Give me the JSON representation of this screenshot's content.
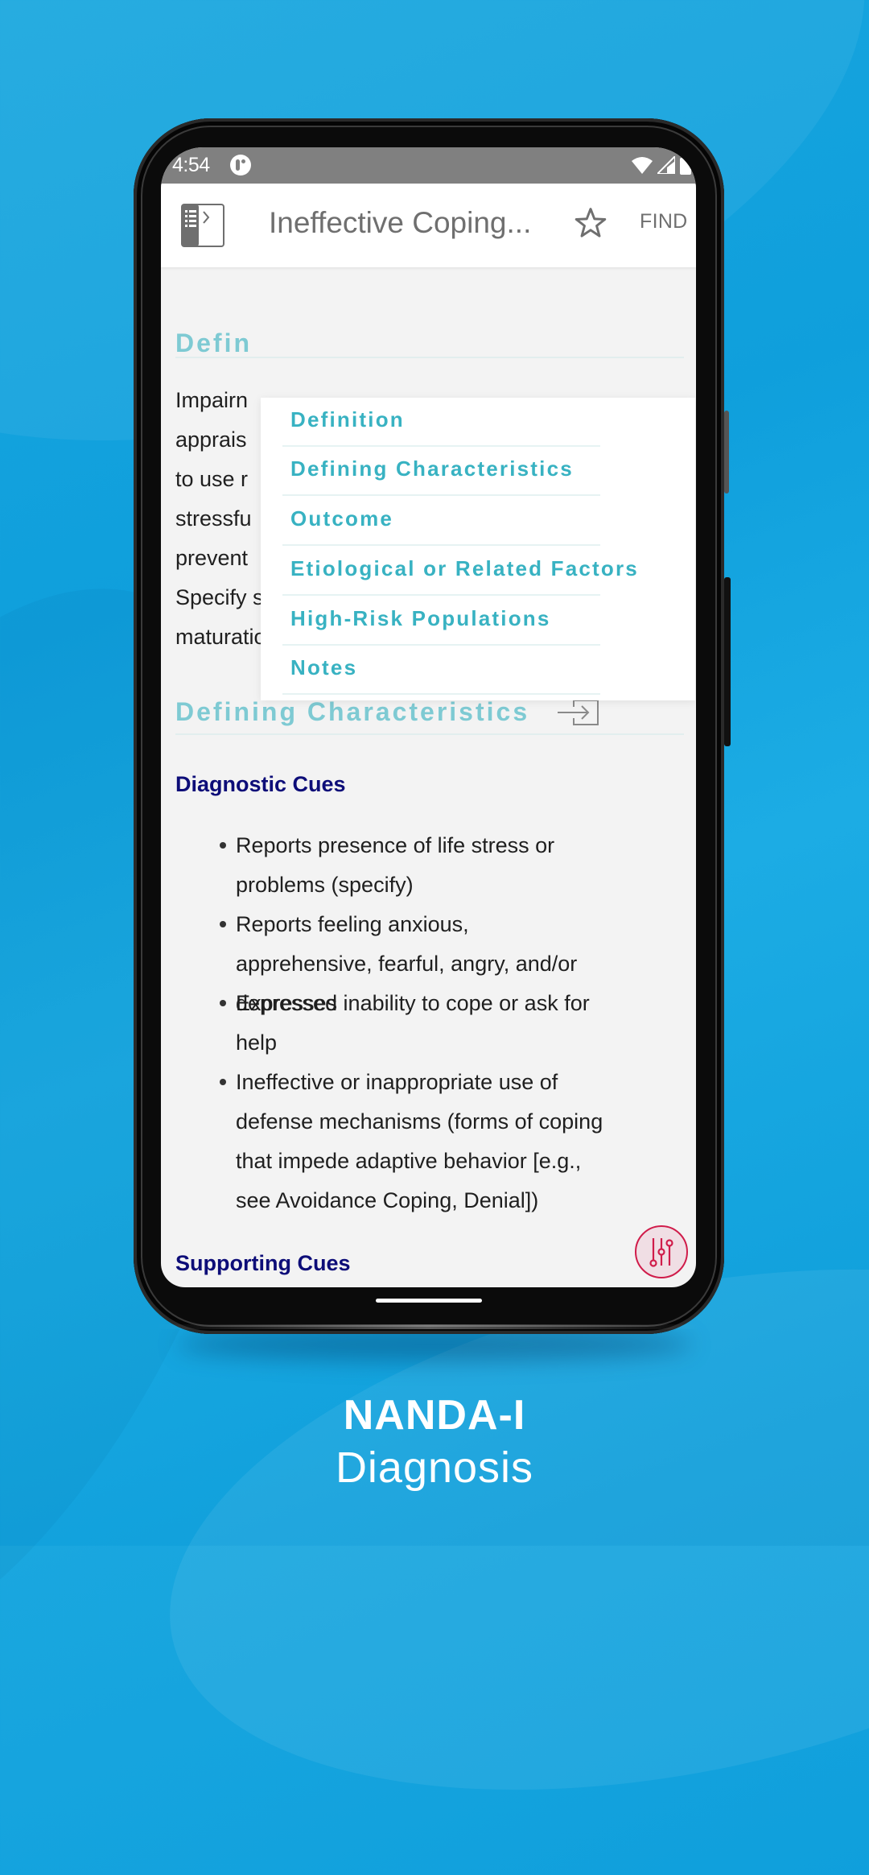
{
  "status_bar": {
    "time": "4:54",
    "icons": [
      "app-notification-icon",
      "wifi-icon",
      "cellular-signal-icon",
      "battery-icon"
    ]
  },
  "app_bar": {
    "title": "Ineffective Coping...",
    "toc_icon": "table-of-contents-icon",
    "favorite_icon": "star-outline-icon",
    "find_label": "FIND"
  },
  "content": {
    "definition_heading": "Defin",
    "definition_lines": [
      "Impairn",
      "apprais",
      "to use r",
      "stressfu",
      "prevent",
      "Specify stressor(s) (e.g., situational or",
      "maturational crises, uncertainty)"
    ],
    "defining_characteristics_heading": "Defining Characteristics",
    "jump_icon": "enter-section-icon",
    "diagnostic_cues_heading": "Diagnostic Cues",
    "diagnostic_cues": [
      "Reports presence of life stress or problems (specify)",
      "Reports feeling anxious, apprehensive, fearful, angry, and/or depressed",
      "Expresses inability to cope or ask for help",
      "Ineffective or inappropriate use of defense mechanisms (forms of coping that impede adaptive behavior [e.g., see Avoidance Coping, Denial])"
    ],
    "supporting_cues_heading": "Supporting Cues"
  },
  "toc_menu": {
    "items": [
      {
        "label": "Definition"
      },
      {
        "label": "Defining Characteristics"
      },
      {
        "label": "Outcome"
      },
      {
        "label": "Etiological or Related Factors"
      },
      {
        "label": "High-Risk Populations"
      },
      {
        "label": "Notes"
      }
    ]
  },
  "fab": {
    "icon": "filter-sliders-icon"
  },
  "promo": {
    "title": "NANDA-I",
    "subtitle": "Diagnosis"
  },
  "colors": {
    "background_blue": "#0f9fdc",
    "section_heading": "#7ecad3",
    "toc_text": "#38b2c2",
    "subheading_navy": "#0d0d78",
    "fab_accent": "#d01c4a",
    "status_bar": "#808080"
  }
}
